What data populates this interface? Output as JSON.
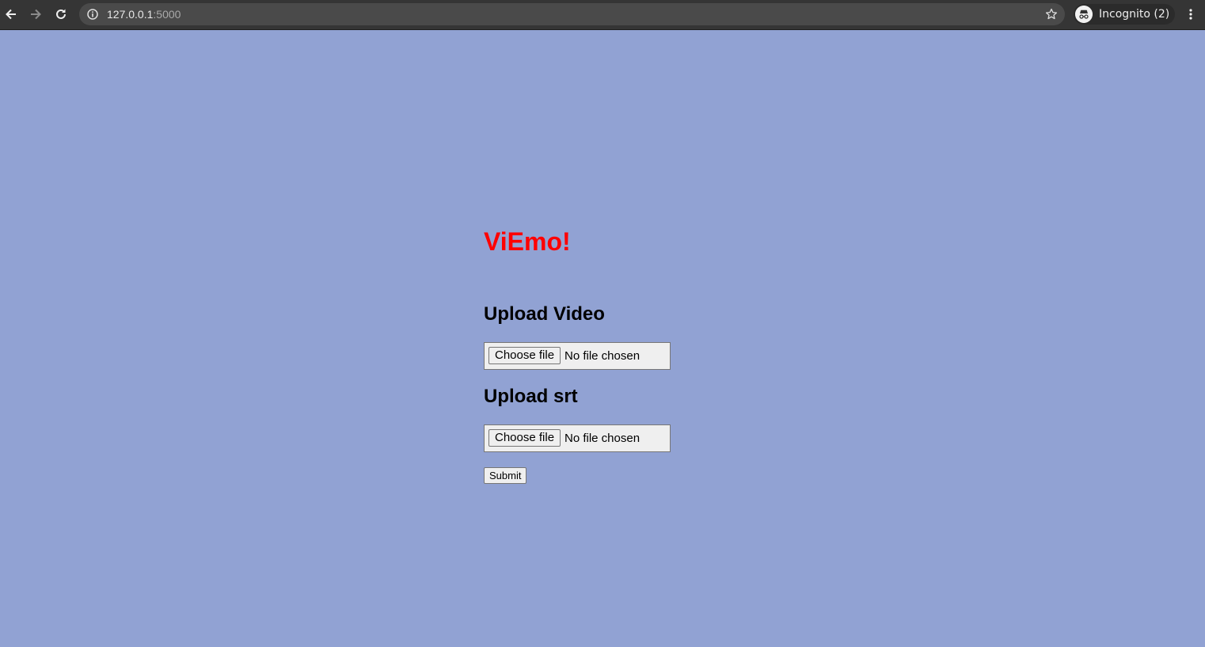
{
  "browser": {
    "url_host": "127.0.0.1",
    "url_port": ":5000",
    "profile_label": "Incognito (2)",
    "icons": {
      "back": "back-arrow-icon",
      "forward": "forward-arrow-icon",
      "reload": "reload-icon",
      "site_info": "info-icon",
      "bookmark": "star-icon",
      "profile": "incognito-icon",
      "menu": "more-vertical-icon"
    },
    "colors": {
      "toolbar": "#353535",
      "omnibox": "#4a4a4a"
    }
  },
  "page": {
    "title": "ViEmo!",
    "title_color": "#ff0000",
    "background_color": "#91a2d3",
    "video_upload": {
      "heading": "Upload Video",
      "button_label": "Choose file",
      "status_text": "No file chosen"
    },
    "srt_upload": {
      "heading": "Upload srt",
      "button_label": "Choose file",
      "status_text": "No file chosen"
    },
    "submit_label": "Submit"
  }
}
